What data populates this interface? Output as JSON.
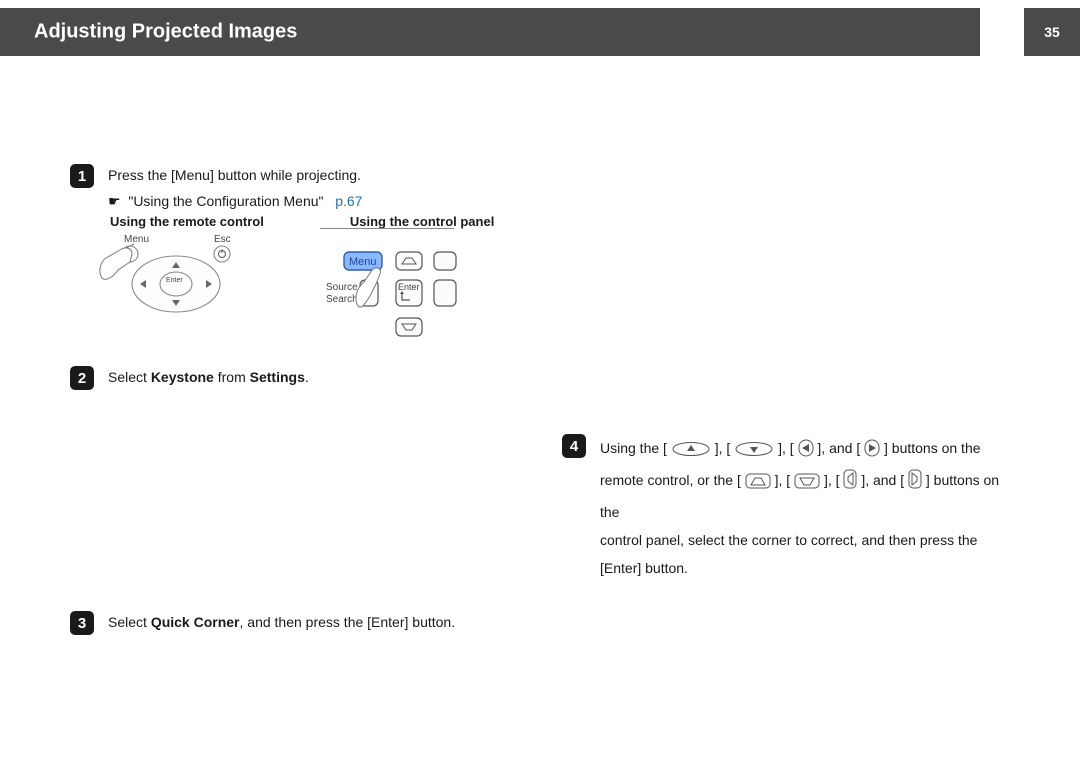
{
  "header": {
    "title": "Adjusting Projected Images",
    "page_number": "35"
  },
  "steps": {
    "s1": {
      "num": "1",
      "line1": "Press the [Menu] button while projecting.",
      "xref_label": "\"Using the Configuration Menu\"",
      "xref_page": "p.67",
      "col_left_heading": "Using the remote control",
      "col_right_heading": "Using the control panel"
    },
    "s2": {
      "num": "2",
      "pre": "Select ",
      "b1": "Keystone",
      "mid": " from ",
      "b2": "Settings",
      "post": "."
    },
    "s3": {
      "num": "3",
      "pre": "Select ",
      "b1": "Quick Corner",
      "post": ", and then press the [Enter] button."
    },
    "s4": {
      "num": "4",
      "line_a_pre": "Using the [",
      "line_a_mid1": "], [",
      "line_a_mid2": "], [",
      "line_a_mid3": "], and [",
      "line_a_post": "] buttons on the",
      "line_b_pre": "remote control, or the [",
      "line_b_mid1": "], [",
      "line_b_mid2": "], [",
      "line_b_mid3": "], and [",
      "line_b_post": "] buttons on the",
      "line_c": "control panel, select the corner to correct, and then press the [Enter] button."
    }
  },
  "illus": {
    "remote_menu_label": "Menu",
    "remote_esc_label": "Esc",
    "remote_enter_label": "Enter",
    "panel_menu_label": "Menu",
    "panel_source_label": "Source",
    "panel_search_label": "Search",
    "panel_enter_label": "Enter"
  }
}
